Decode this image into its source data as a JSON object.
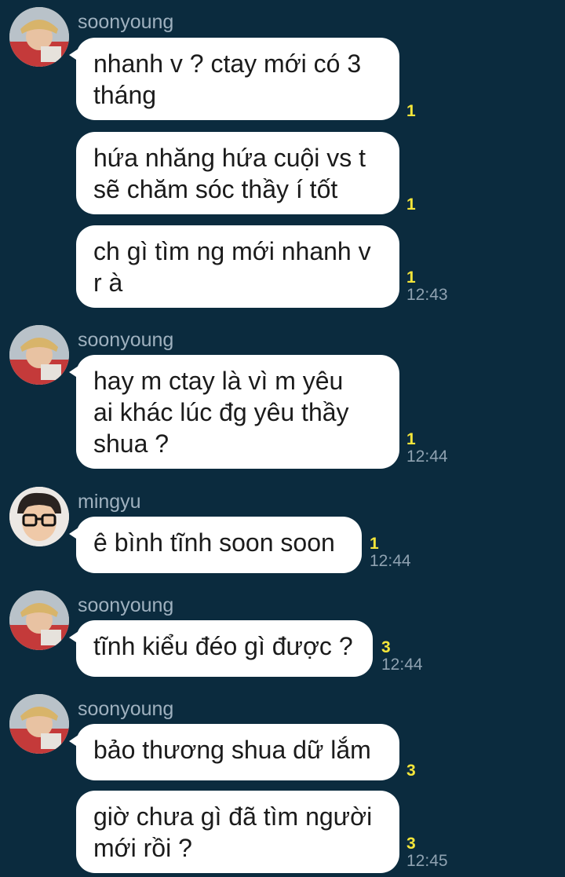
{
  "groups": [
    {
      "sender": "soonyoung",
      "avatar": "soonyoung-avatar",
      "messages": [
        {
          "lines": [
            "nhanh v ? ctay mới có 3",
            "tháng"
          ],
          "unread": "1",
          "time": ""
        },
        {
          "lines": [
            "hứa nhăng hứa cuội vs t",
            "sẽ chăm sóc thầy í tốt"
          ],
          "unread": "1",
          "time": ""
        },
        {
          "lines": [
            "ch gì tìm ng mới nhanh v",
            "r à"
          ],
          "unread": "1",
          "time": "12:43"
        }
      ]
    },
    {
      "sender": "soonyoung",
      "avatar": "soonyoung-avatar",
      "messages": [
        {
          "lines": [
            "hay m ctay là vì m yêu",
            "ai khác lúc đg yêu thầy",
            "shua ?"
          ],
          "unread": "1",
          "time": "12:44"
        }
      ]
    },
    {
      "sender": "mingyu",
      "avatar": "mingyu-avatar",
      "messages": [
        {
          "lines": [
            "ê bình tĩnh soon soon"
          ],
          "unread": "1",
          "time": "12:44"
        }
      ]
    },
    {
      "sender": "soonyoung",
      "avatar": "soonyoung-avatar",
      "messages": [
        {
          "lines": [
            "tĩnh kiểu đéo gì được ?"
          ],
          "unread": "3",
          "time": "12:44"
        }
      ]
    },
    {
      "sender": "soonyoung",
      "avatar": "soonyoung-avatar",
      "messages": [
        {
          "lines": [
            "bảo thương shua dữ lắm"
          ],
          "unread": "3",
          "time": ""
        },
        {
          "lines": [
            "giờ chưa gì đã tìm người",
            "mới rồi ?"
          ],
          "unread": "3",
          "time": "12:45"
        }
      ]
    }
  ],
  "colors": {
    "background": "#0b2b3e",
    "bubble": "#ffffff",
    "unread": "#f5e63a",
    "time": "#8fa2b1",
    "sender": "#9fb1bf"
  }
}
